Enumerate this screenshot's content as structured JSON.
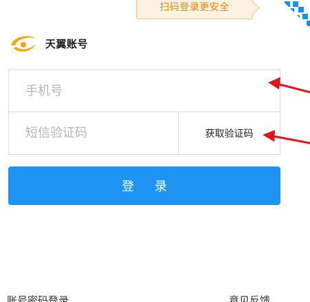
{
  "qr_tip": {
    "text": "扫码登录更安全"
  },
  "brand": {
    "name": "天翼账号",
    "logo": "telecom-logo-icon",
    "logo_color": "#f7a600"
  },
  "form": {
    "phone_placeholder": "手机号",
    "code_placeholder": "短信验证码",
    "get_code_label": "获取验证码"
  },
  "login_button": {
    "label": "登 录",
    "color": "#1e93f2"
  },
  "footer": {
    "password_login": "账号密码登录",
    "feedback": "意见反馈"
  },
  "annotations": {
    "arrow_color": "#e0141a"
  }
}
